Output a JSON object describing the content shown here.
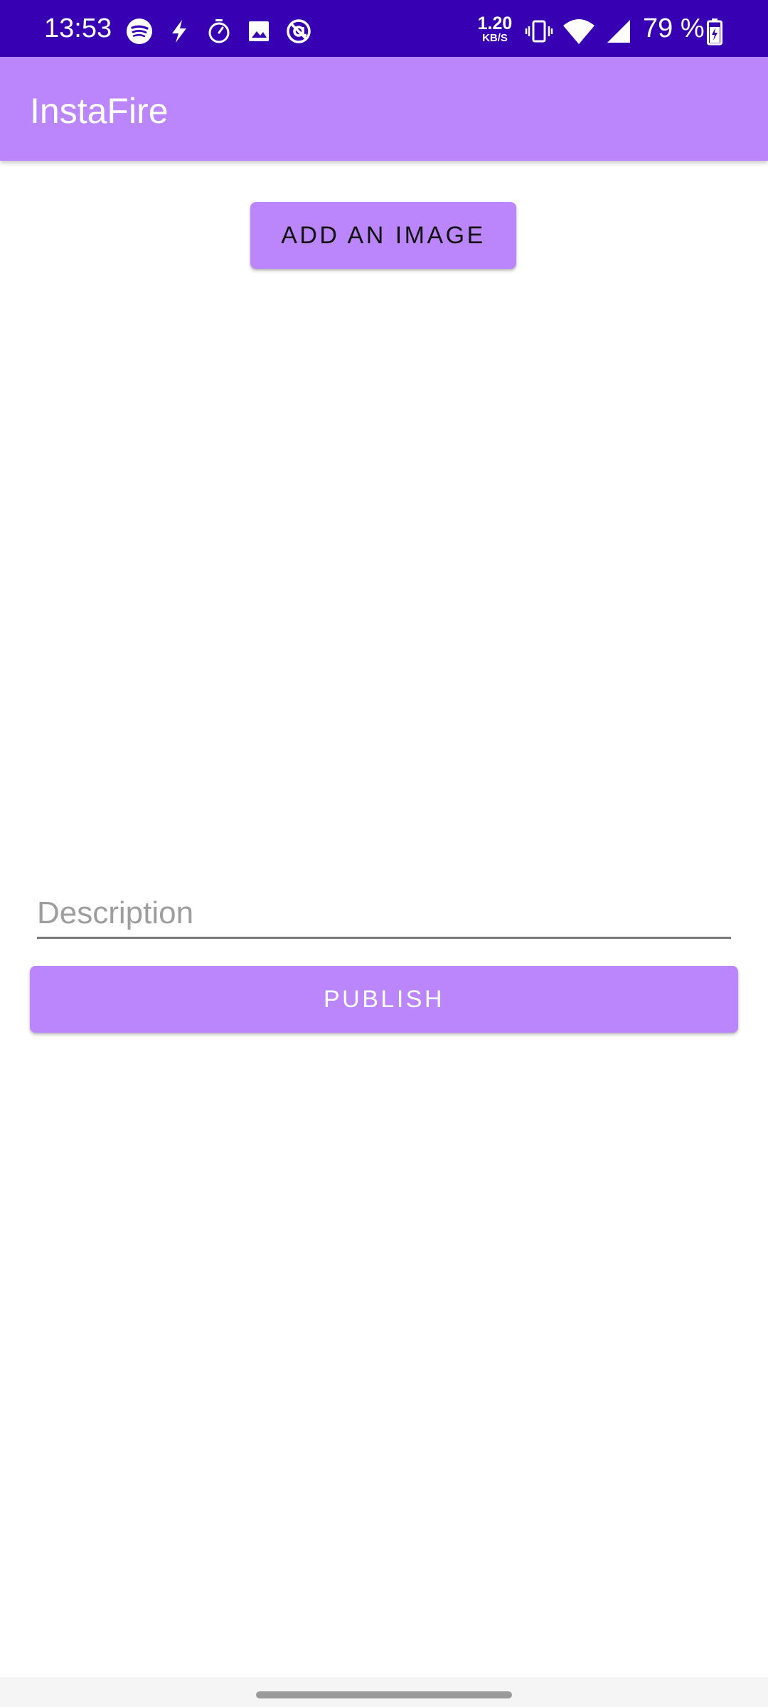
{
  "status_bar": {
    "time": "13:53",
    "net_speed_value": "1.20",
    "net_speed_unit": "KB/S",
    "battery_percent": "79 %",
    "left_icons": [
      "spotify-icon",
      "flash-icon",
      "timer-icon",
      "image-icon",
      "at-sign-icon"
    ],
    "right_icons": [
      "vibrate-icon",
      "wifi-icon",
      "signal-icon",
      "battery-icon"
    ],
    "background_color": "#3700b3"
  },
  "app_bar": {
    "title": "InstaFire",
    "background_color": "#bb86fc"
  },
  "main": {
    "add_image_label": "ADD AN IMAGE",
    "description_placeholder": "Description",
    "description_value": "",
    "publish_label": "PUBLISH"
  },
  "colors": {
    "accent": "#bb86fc",
    "primary_dark": "#3700b3"
  }
}
